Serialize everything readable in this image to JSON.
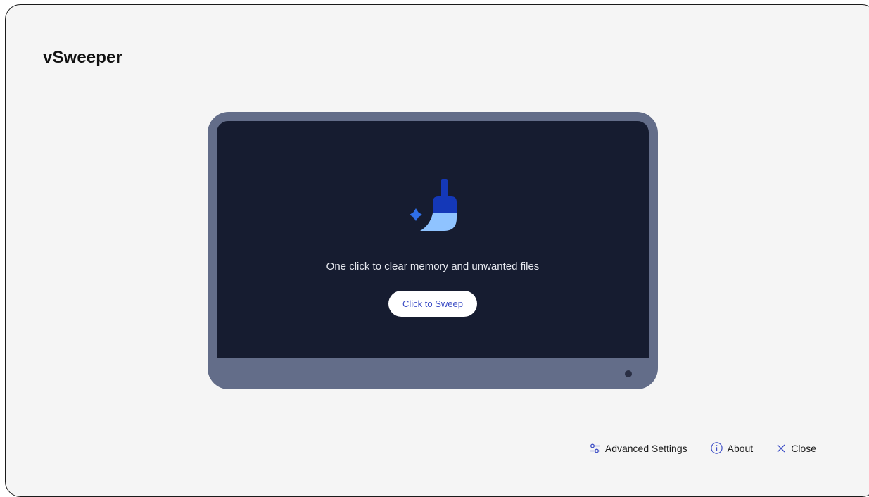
{
  "app": {
    "title": "vSweeper"
  },
  "main": {
    "tagline": "One click to clear memory and unwanted files",
    "sweep_button": "Click to Sweep",
    "icon": "broom-sparkle-icon"
  },
  "footer": {
    "advanced_settings": {
      "label": "Advanced Settings",
      "icon": "sliders-icon"
    },
    "about": {
      "label": "About",
      "icon": "info-icon"
    },
    "close": {
      "label": "Close",
      "icon": "close-icon"
    }
  },
  "colors": {
    "accent": "#3d4ec6",
    "screen": "#161c30",
    "monitor_bezel": "#636d89",
    "broom_handle": "#1438b8",
    "broom_bristles": "#8fc3ff",
    "sparkle": "#2f6fe8"
  }
}
